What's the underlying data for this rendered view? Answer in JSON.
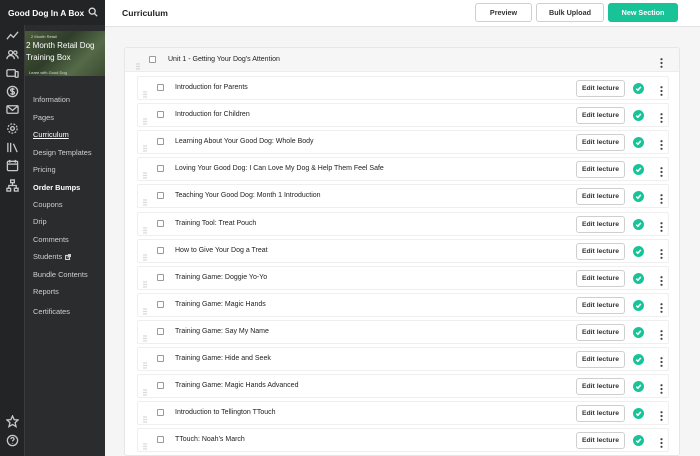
{
  "app": {
    "school_name": "Good Dog In A Box"
  },
  "course": {
    "title": "2 Month Retail Dog Training Box",
    "thumb_tag": "2 Month Retail",
    "thumb_sub": "Learn with Good Dog"
  },
  "sidebar": {
    "items": [
      {
        "label": "Information"
      },
      {
        "label": "Pages"
      },
      {
        "label": "Curriculum"
      },
      {
        "label": "Design Templates"
      },
      {
        "label": "Pricing"
      },
      {
        "label": "Order Bumps"
      },
      {
        "label": "Coupons"
      },
      {
        "label": "Drip"
      },
      {
        "label": "Comments"
      },
      {
        "label": "Students"
      },
      {
        "label": "Bundle Contents"
      },
      {
        "label": "Reports"
      },
      {
        "label": "Certificates"
      }
    ]
  },
  "header": {
    "title": "Curriculum",
    "preview_label": "Preview",
    "bulk_upload_label": "Bulk Upload",
    "new_section_label": "New Section"
  },
  "section": {
    "title": "Unit 1 - Getting Your Dog's Attention"
  },
  "lectures": [
    {
      "title": "Introduction for Parents"
    },
    {
      "title": "Introduction for Children"
    },
    {
      "title": "Learning About Your Good Dog: Whole Body"
    },
    {
      "title": "Loving Your Good Dog: I Can Love My Dog & Help Them Feel Safe"
    },
    {
      "title": "Teaching Your Good Dog: Month 1 Introduction"
    },
    {
      "title": "Training Tool: Treat Pouch"
    },
    {
      "title": "How to Give Your Dog a Treat"
    },
    {
      "title": "Training Game: Doggie Yo-Yo"
    },
    {
      "title": "Training Game: Magic Hands"
    },
    {
      "title": "Training Game: Say My Name"
    },
    {
      "title": "Training Game: Hide and Seek"
    },
    {
      "title": "Training Game: Magic Hands Advanced"
    },
    {
      "title": "Introduction to Tellington TTouch"
    },
    {
      "title": "TTouch: Noah's March"
    }
  ],
  "edit_lecture_label": "Edit lecture",
  "colors": {
    "accent": "#17c397",
    "sidebar_bg": "#2b2c2e",
    "rail_bg": "#232426"
  }
}
